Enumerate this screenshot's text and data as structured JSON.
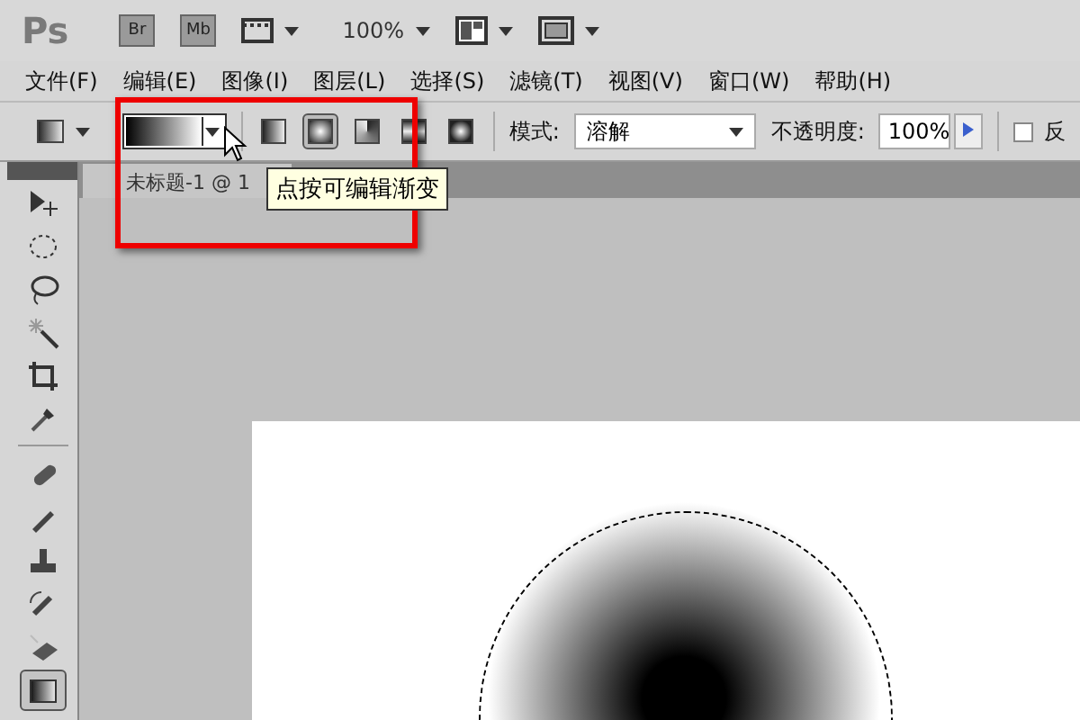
{
  "app_bar": {
    "logo": "Ps",
    "buttons": [
      "Br",
      "Mb"
    ],
    "zoom": "100%"
  },
  "menu": [
    "文件(F)",
    "编辑(E)",
    "图像(I)",
    "图层(L)",
    "选择(S)",
    "滤镜(T)",
    "视图(V)",
    "窗口(W)",
    "帮助(H)"
  ],
  "options": {
    "gradient_types": [
      {
        "kind": "linear",
        "selected": false
      },
      {
        "kind": "radial",
        "selected": true
      },
      {
        "kind": "angle",
        "selected": false
      },
      {
        "kind": "reflected",
        "selected": false
      },
      {
        "kind": "diamond",
        "selected": false
      }
    ],
    "mode_label": "模式:",
    "mode_value": "溶解",
    "opacity_label": "不透明度:",
    "opacity_value": "100%",
    "reverse": {
      "label": "反",
      "checked": false
    }
  },
  "tooltip": "点按可编辑渐变",
  "document_tab": "未标题-1 @ 1",
  "tools": [
    {
      "kind": "move",
      "selected": false
    },
    {
      "kind": "marquee",
      "selected": false
    },
    {
      "kind": "lasso",
      "selected": false
    },
    {
      "kind": "wand",
      "selected": false
    },
    {
      "kind": "crop",
      "selected": false
    },
    {
      "kind": "eyedropper",
      "selected": false
    },
    {
      "kind": "divider"
    },
    {
      "kind": "healing",
      "selected": false
    },
    {
      "kind": "brush",
      "selected": false
    },
    {
      "kind": "stamp",
      "selected": false
    },
    {
      "kind": "history",
      "selected": false
    },
    {
      "kind": "eraser",
      "selected": false
    },
    {
      "kind": "gradient",
      "selected": true
    }
  ]
}
